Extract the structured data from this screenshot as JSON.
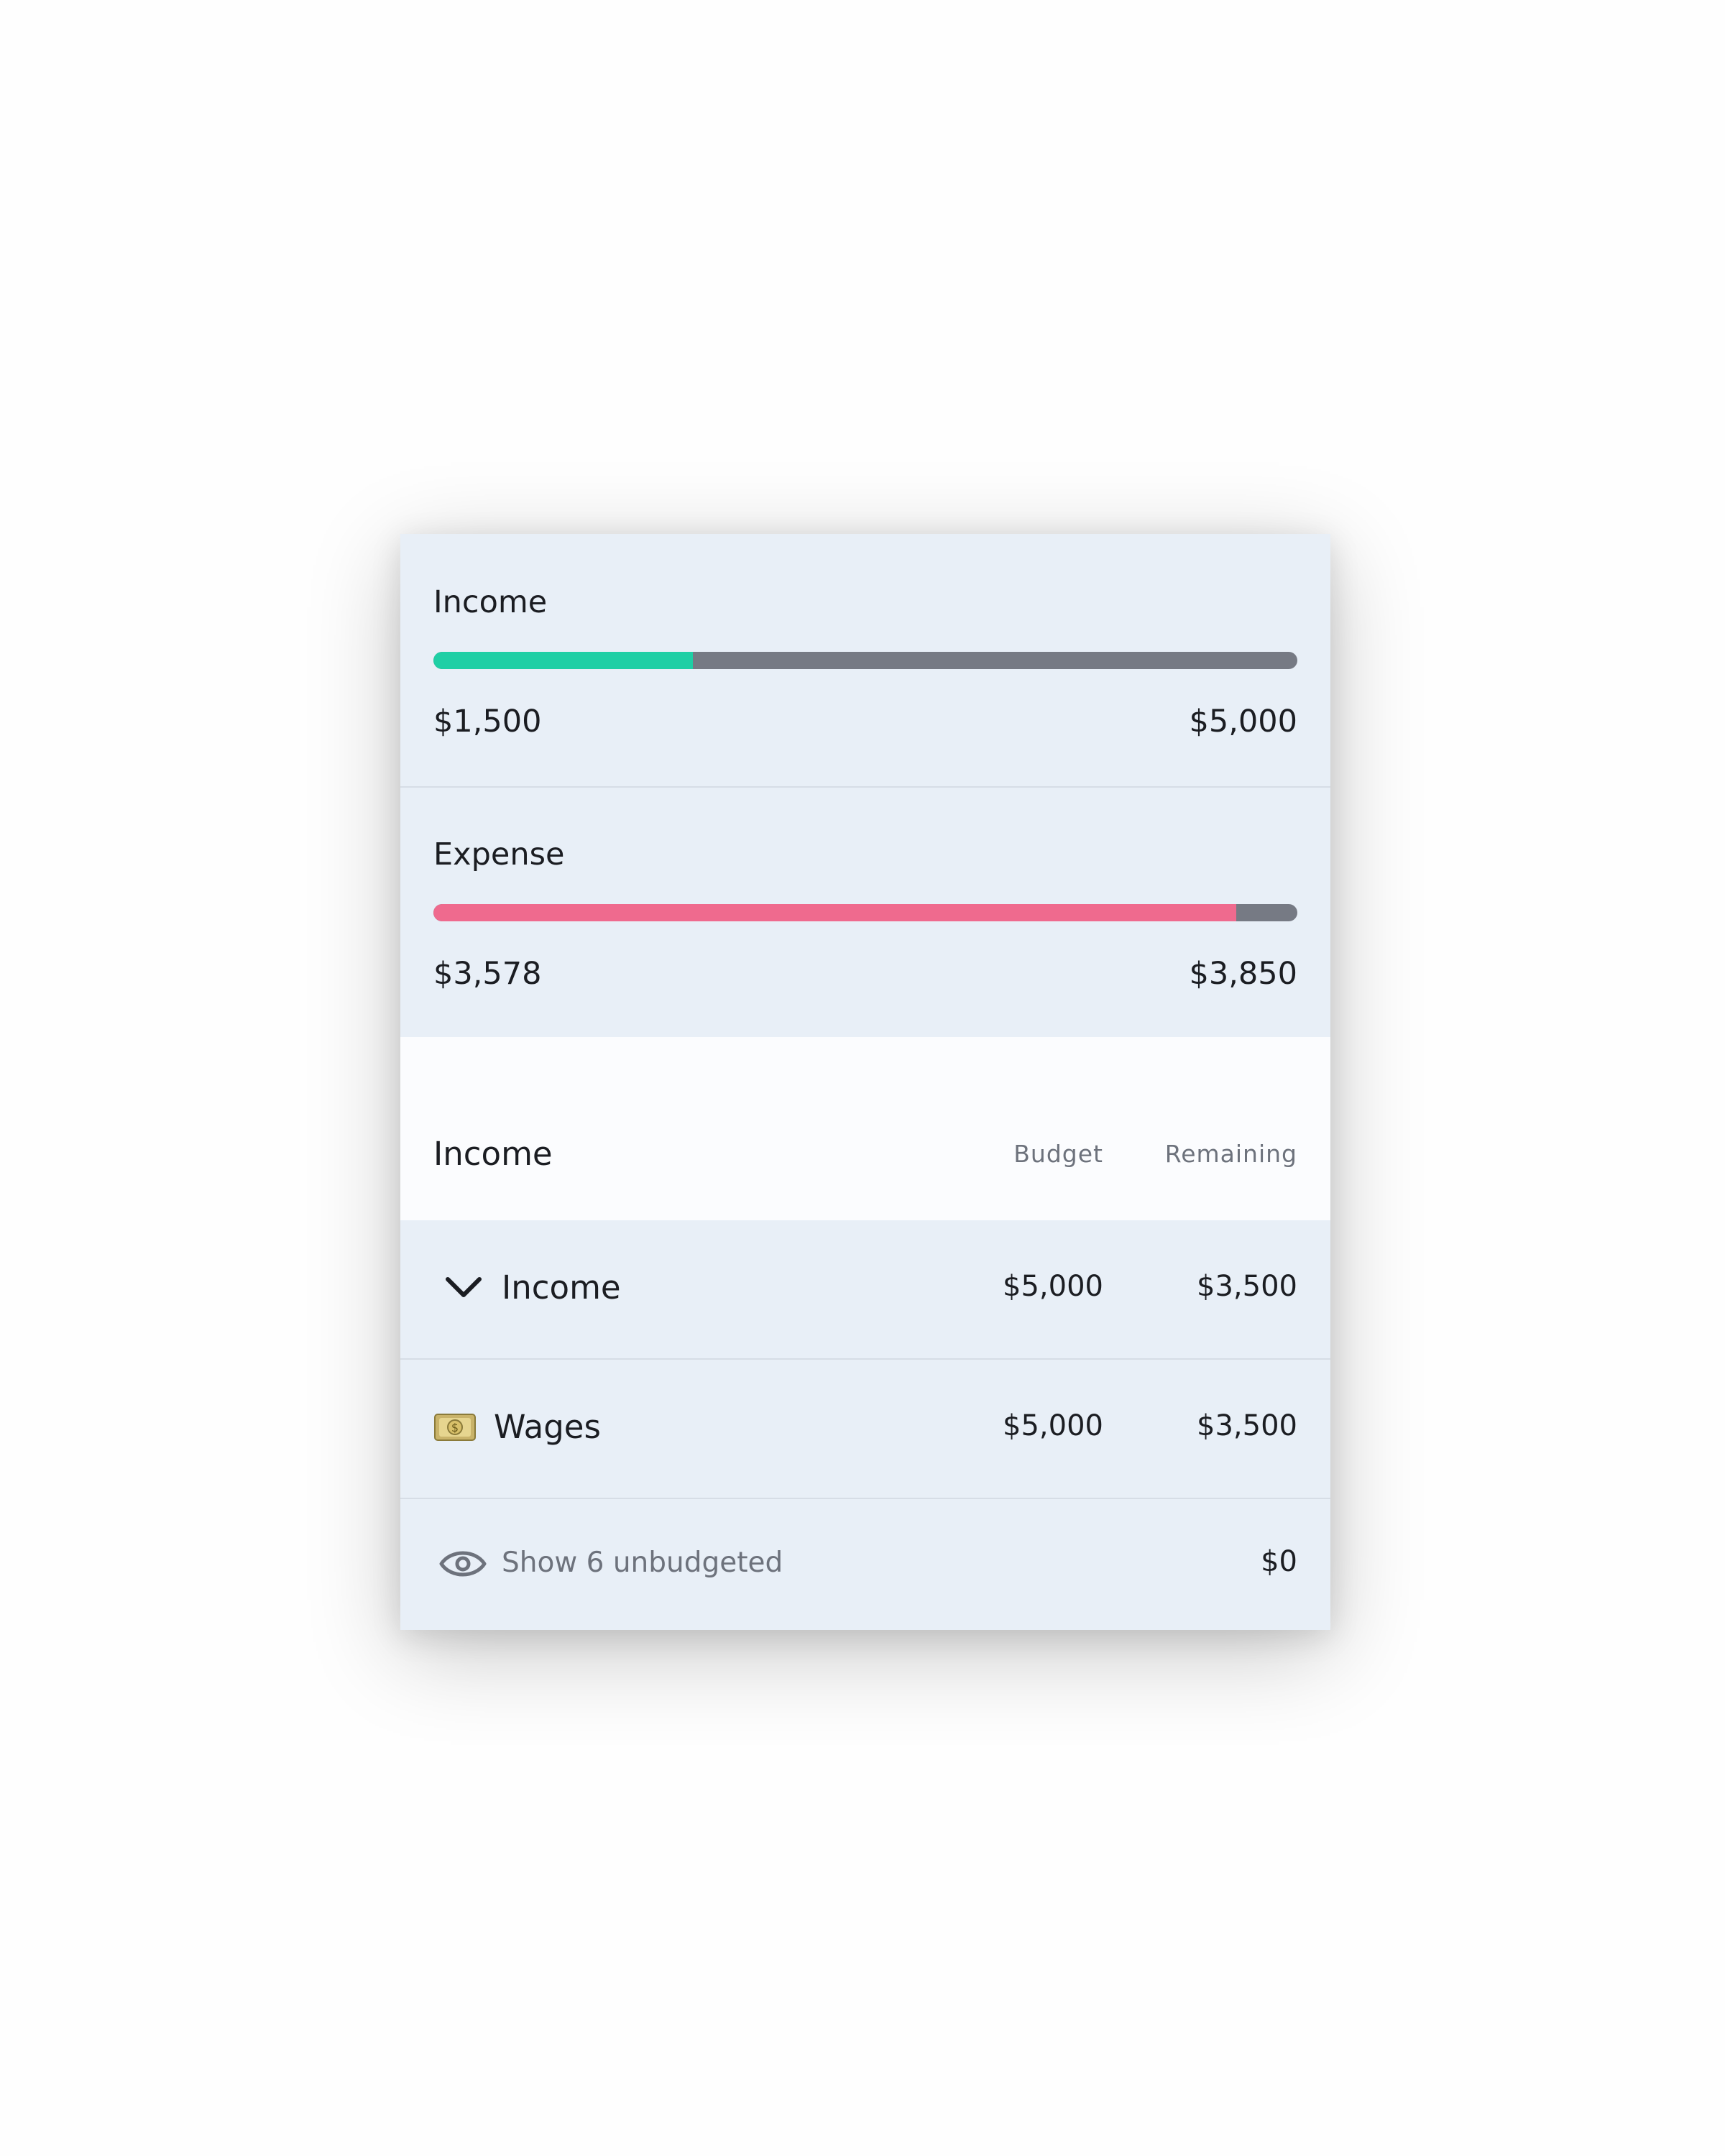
{
  "summary": {
    "income": {
      "label": "Income",
      "actual": "$1,500",
      "target": "$5,000",
      "progress_fraction": 0.3,
      "fill_color": "#1fcfa5",
      "track_color": "#767a84"
    },
    "expense": {
      "label": "Expense",
      "actual": "$3,578",
      "target": "$3,850",
      "progress_fraction": 0.929,
      "fill_color": "#ef6a8e",
      "track_color": "#767a84"
    }
  },
  "table": {
    "section_title": "Income",
    "columns": {
      "budget": "Budget",
      "remaining": "Remaining"
    },
    "group": {
      "icon": "chevron-down-icon",
      "label": "Income",
      "budget": "$5,000",
      "remaining": "$3,500"
    },
    "items": [
      {
        "icon": "money-bill-icon",
        "label": "Wages",
        "budget": "$5,000",
        "remaining": "$3,500"
      }
    ],
    "footer": {
      "icon": "eye-icon",
      "label": "Show 6 unbudgeted",
      "amount": "$0"
    }
  }
}
